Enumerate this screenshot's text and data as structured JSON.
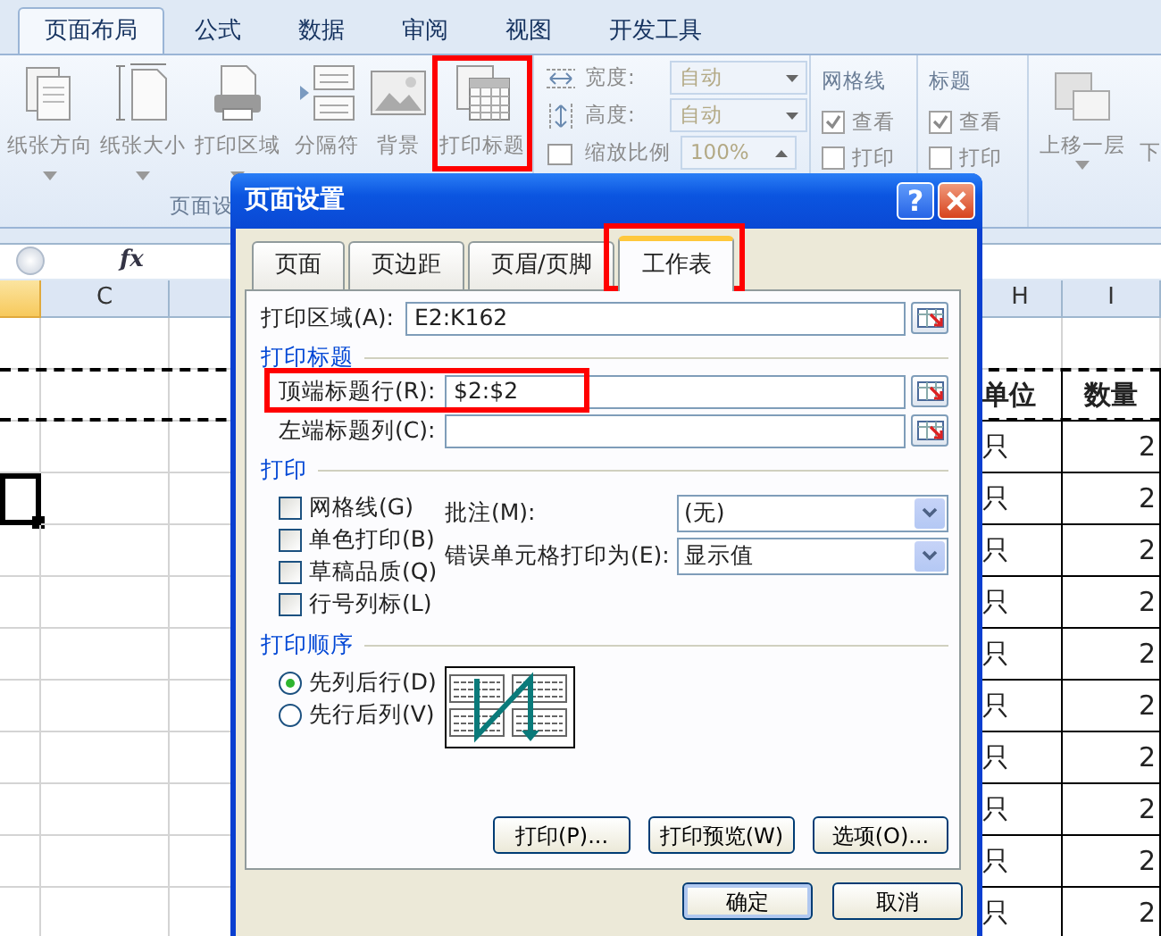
{
  "ribbon": {
    "tabs": [
      {
        "label": "页面布局",
        "selected": true
      },
      {
        "label": "公式",
        "selected": false
      },
      {
        "label": "数据",
        "selected": false
      },
      {
        "label": "审阅",
        "selected": false
      },
      {
        "label": "视图",
        "selected": false
      },
      {
        "label": "开发工具",
        "selected": false
      }
    ],
    "page_setup": {
      "buttons": [
        {
          "label": "纸张方向",
          "kind": "orientation",
          "has_menu": true,
          "highlighted": false
        },
        {
          "label": "纸张大小",
          "kind": "size",
          "has_menu": true,
          "highlighted": false
        },
        {
          "label": "打印区域",
          "kind": "area",
          "has_menu": true,
          "highlighted": false
        },
        {
          "label": "分隔符",
          "kind": "breaks",
          "has_menu": false,
          "highlighted": false
        },
        {
          "label": "背景",
          "kind": "background",
          "has_menu": false,
          "highlighted": false
        },
        {
          "label": "打印标题",
          "kind": "print_titles",
          "has_menu": false,
          "highlighted": true
        }
      ],
      "group_label": "页面设"
    },
    "scale": [
      {
        "label": "宽度:",
        "value": "自动",
        "kind": "width"
      },
      {
        "label": "高度:",
        "value": "自动",
        "kind": "height"
      },
      {
        "label": "缩放比例",
        "value": "100%",
        "kind": "scale"
      }
    ],
    "sheet_options": [
      {
        "title": "网格线",
        "options": [
          {
            "label": "查看",
            "checked": true
          },
          {
            "label": "打印",
            "checked": false
          }
        ]
      },
      {
        "title": "标题",
        "options": [
          {
            "label": "查看",
            "checked": true
          },
          {
            "label": "打印",
            "checked": false
          }
        ]
      }
    ],
    "arrange": [
      "上移一层",
      "下"
    ]
  },
  "formula_bar": {
    "function_label": "fx"
  },
  "sheet": {
    "columns": [
      {
        "selected": true
      },
      {
        "label": "C",
        "selected": false
      },
      {
        "selected": false
      },
      {
        "label": "H",
        "selected": false
      },
      {
        "label": "I",
        "selected": false
      }
    ],
    "rows": [
      {
        "kind": "blank",
        "marquee": false,
        "active": false
      },
      {
        "kind": "header",
        "unit": "单位",
        "qty": "数量",
        "marquee": true,
        "active": false
      },
      {
        "kind": "data",
        "unit": "只",
        "qty": "2",
        "marquee": false,
        "active": false
      },
      {
        "kind": "data",
        "unit": "只",
        "qty": "2",
        "marquee": false,
        "active": true
      },
      {
        "kind": "data",
        "unit": "只",
        "qty": "2",
        "marquee": false,
        "active": false
      },
      {
        "kind": "data",
        "unit": "只",
        "qty": "2",
        "marquee": false,
        "active": false
      },
      {
        "kind": "data",
        "unit": "只",
        "qty": "2",
        "marquee": false,
        "active": false
      },
      {
        "kind": "data",
        "unit": "只",
        "qty": "2",
        "marquee": false,
        "active": false
      },
      {
        "kind": "data",
        "unit": "只",
        "qty": "2",
        "marquee": false,
        "active": false
      },
      {
        "kind": "data",
        "unit": "只",
        "qty": "2",
        "marquee": false,
        "active": false
      },
      {
        "kind": "data",
        "unit": "只",
        "qty": "2",
        "marquee": false,
        "active": false
      },
      {
        "kind": "data",
        "unit": "只",
        "qty": "2",
        "marquee": false,
        "active": false
      }
    ]
  },
  "dialog": {
    "title": "页面设置",
    "help": "?",
    "tabs": [
      {
        "label": "页面",
        "selected": false,
        "highlighted": false
      },
      {
        "label": "页边距",
        "selected": false,
        "highlighted": false
      },
      {
        "label": "页眉/页脚",
        "selected": false,
        "highlighted": false
      },
      {
        "label": "工作表",
        "selected": true,
        "highlighted": true
      }
    ],
    "print_area": {
      "label": "打印区域(A):",
      "value": "E2:K162"
    },
    "print_titles": {
      "heading": "打印标题",
      "fields": [
        {
          "label": "顶端标题行(R):",
          "value": "$2:$2",
          "highlighted": true
        },
        {
          "label": "左端标题列(C):",
          "highlighted": false
        }
      ]
    },
    "print": {
      "heading": "打印",
      "checkboxes": [
        {
          "label": "网格线(G)",
          "checked": false
        },
        {
          "label": "单色打印(B)",
          "checked": false
        },
        {
          "label": "草稿品质(Q)",
          "checked": false
        },
        {
          "label": "行号列标(L)",
          "checked": false
        }
      ],
      "dropdowns": [
        {
          "label": "批注(M):",
          "value": "(无)"
        },
        {
          "label": "错误单元格打印为(E):",
          "value": "显示值"
        }
      ]
    },
    "print_order": {
      "heading": "打印顺序",
      "options": [
        {
          "label": "先列后行(D)",
          "selected": true
        },
        {
          "label": "先行后列(V)",
          "selected": false
        }
      ]
    },
    "panel_buttons": [
      "打印(P)...",
      "打印预览(W)",
      "选项(O)..."
    ],
    "footer_buttons": [
      "确定",
      "取消"
    ]
  }
}
